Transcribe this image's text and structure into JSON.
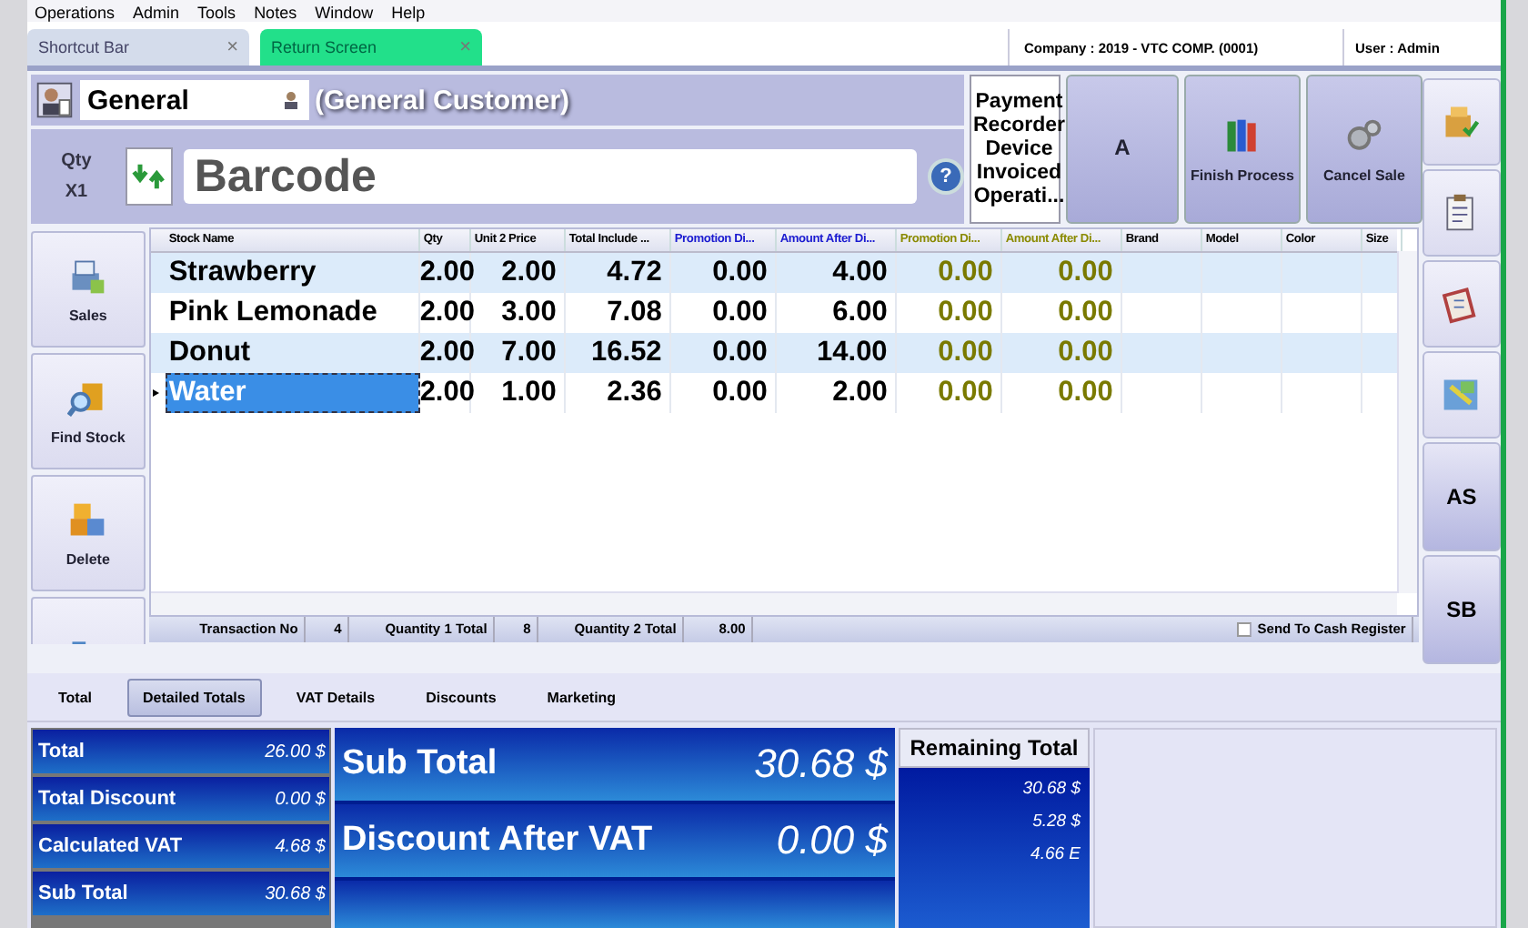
{
  "menu": [
    "Operations",
    "Admin",
    "Tools",
    "Notes",
    "Window",
    "Help"
  ],
  "doc_tabs": [
    {
      "label": "Shortcut Bar",
      "selected": false,
      "close": "×"
    },
    {
      "label": "Return Screen",
      "selected": true,
      "close": "×"
    }
  ],
  "company": "Company : 2019 - VTC COMP. (0001)",
  "user": "User : Admin",
  "customer": {
    "code": "General",
    "name": "(General Customer)"
  },
  "qty": {
    "label": "Qty",
    "value": "X1"
  },
  "barcode": {
    "placeholder": "Barcode"
  },
  "help": "?",
  "payment_recorder": "Payment Recorder Device Invoiced Operati...",
  "actions": [
    {
      "kind": "text",
      "label": "A"
    },
    {
      "kind": "books",
      "label": "Finish Process"
    },
    {
      "kind": "gears",
      "label": "Cancel Sale"
    }
  ],
  "side_buttons": [
    {
      "kind": "register",
      "label": "Sales"
    },
    {
      "kind": "search",
      "label": "Find Stock"
    },
    {
      "kind": "boxes",
      "label": "Delete"
    },
    {
      "kind": "bins"
    }
  ],
  "right_buttons": [
    {
      "kind": "box"
    },
    {
      "kind": "clipboard"
    },
    {
      "kind": "card"
    },
    {
      "kind": "map"
    },
    {
      "kind": "text",
      "label": "AS"
    },
    {
      "kind": "text",
      "label": "SB"
    }
  ],
  "table": {
    "columns": [
      {
        "label": "Stock Name",
        "kind": "name"
      },
      {
        "label": "Qty",
        "kind": "num"
      },
      {
        "label": "Unit 2 Price",
        "kind": "num"
      },
      {
        "label": "Total Include ...",
        "kind": "num"
      },
      {
        "label": "Promotion Di...",
        "kind": "promo"
      },
      {
        "label": "Amount After Di...",
        "kind": "promo"
      },
      {
        "label": "Promotion Di...",
        "kind": "promo2"
      },
      {
        "label": "Amount After Di...",
        "kind": "promo2"
      },
      {
        "label": "Brand",
        "kind": "text"
      },
      {
        "label": "Model",
        "kind": "text"
      },
      {
        "label": "Color",
        "kind": "text"
      },
      {
        "label": "Size",
        "kind": "text"
      }
    ],
    "rows": [
      {
        "selected": false,
        "cells": [
          "Strawberry",
          "2.00",
          "2.00",
          "4.72",
          "0.00",
          "4.00",
          "0.00",
          "0.00"
        ]
      },
      {
        "selected": false,
        "cells": [
          "Pink Lemonade",
          "2.00",
          "3.00",
          "7.08",
          "0.00",
          "6.00",
          "0.00",
          "0.00"
        ]
      },
      {
        "selected": false,
        "cells": [
          "Donut",
          "2.00",
          "7.00",
          "16.52",
          "0.00",
          "14.00",
          "0.00",
          "0.00"
        ]
      },
      {
        "selected": true,
        "cells": [
          "Water",
          "2.00",
          "1.00",
          "2.36",
          "0.00",
          "2.00",
          "0.00",
          "0.00"
        ]
      }
    ]
  },
  "summary": [
    {
      "label": "Transaction No",
      "value": "4"
    },
    {
      "label": "Quantity 1 Total",
      "value": "8"
    },
    {
      "label": "Quantity 2 Total",
      "value": "8.00"
    }
  ],
  "send_to_cash_register": {
    "label": "Send To Cash Register",
    "checked": false
  },
  "bottom_tabs": [
    {
      "label": "Total",
      "selected": false
    },
    {
      "label": "Detailed Totals",
      "selected": true
    },
    {
      "label": "VAT Details",
      "selected": false
    },
    {
      "label": "Discounts",
      "selected": false
    },
    {
      "label": "Marketing",
      "selected": false
    }
  ],
  "totals": [
    {
      "label": "Total",
      "value": "26.00 $"
    },
    {
      "label": "Total Discount",
      "value": "0.00 $"
    },
    {
      "label": "Calculated VAT",
      "value": "4.68 $"
    },
    {
      "label": "Sub Total",
      "value": "30.68 $"
    }
  ],
  "big_totals": [
    {
      "label": "Sub Total",
      "value": "30.68 $"
    },
    {
      "label": "Discount After VAT",
      "value": "0.00 $"
    }
  ],
  "remaining": {
    "title": "Remaining Total",
    "values": [
      "30.68 $",
      "5.28 $",
      "4.66 E"
    ]
  }
}
